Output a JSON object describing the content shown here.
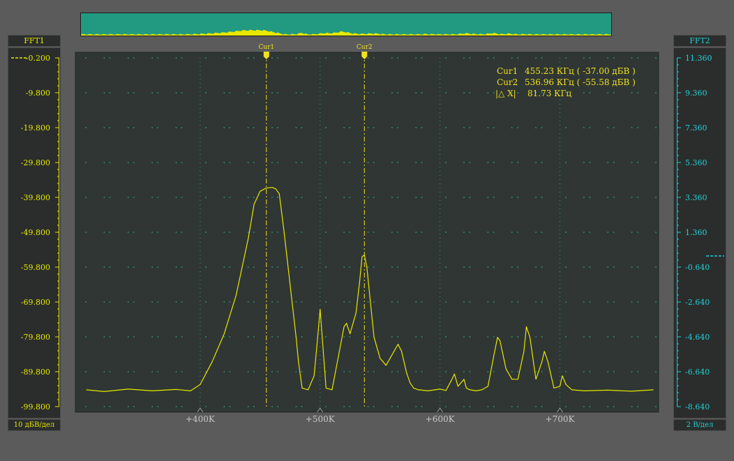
{
  "left_panel": {
    "title": "FFT1",
    "footer": "10 дБВ/дел",
    "color": "#e8e800"
  },
  "right_panel": {
    "title": "FFT2",
    "footer": "2 В/дел",
    "color": "#22d0d6"
  },
  "cursors": [
    {
      "label": "Cur1",
      "x": 455.23
    },
    {
      "label": "Cur2",
      "x": 536.96
    }
  ],
  "readout": {
    "cur1": {
      "name": "Cur1",
      "value": "455.23 КГц ( -37.00 дБВ )"
    },
    "cur2": {
      "name": "Cur2",
      "value": "536.96 КГц ( -55.58 дБВ )"
    },
    "delta": {
      "name": "|△ X|",
      "value": "81.73 КГц"
    }
  },
  "chart_data": {
    "type": "line",
    "title": "",
    "xlabel": "",
    "ylabel": "",
    "xlim": [
      300,
      780
    ],
    "ylim": [
      -99.8,
      -0.2
    ],
    "y2lim": [
      -8.64,
      11.36
    ],
    "grid": true,
    "x_ticks": [
      400,
      500,
      600,
      700
    ],
    "x_tick_labels": [
      "+400K",
      "+500K",
      "+600K",
      "+700K"
    ],
    "y_ticks_left": [
      "-0.200",
      "-9.800",
      "-19.800",
      "-29.800",
      "-39.800",
      "-49.800",
      "-59.800",
      "-69.800",
      "-79.800",
      "-89.800",
      "-99.800"
    ],
    "y_ticks_right": [
      "11.360",
      "9.360",
      "7.360",
      "5.360",
      "3.360",
      "1.360",
      "-0.640",
      "-2.640",
      "-4.640",
      "-6.640",
      "-8.640"
    ],
    "y2_level": 0.0,
    "series": [
      {
        "color": "#e8e800",
        "x": [
          305,
          320,
          340,
          360,
          380,
          392,
          400,
          410,
          420,
          430,
          440,
          445,
          450,
          455,
          460,
          463,
          466,
          470,
          475,
          480,
          482,
          485,
          490,
          495,
          498,
          500,
          502,
          505,
          510,
          515,
          520,
          522,
          525,
          530,
          533,
          535,
          537,
          539,
          542,
          545,
          550,
          555,
          560,
          565,
          568,
          572,
          575,
          578,
          582,
          590,
          600,
          605,
          610,
          612,
          615,
          620,
          622,
          625,
          630,
          635,
          640,
          645,
          648,
          650,
          655,
          660,
          665,
          670,
          672,
          675,
          680,
          685,
          687,
          690,
          695,
          700,
          702,
          705,
          710,
          720,
          740,
          760,
          778
        ],
        "y": [
          -95,
          -95.5,
          -94.8,
          -95.3,
          -94.9,
          -95.3,
          -93.5,
          -87,
          -79,
          -68,
          -52,
          -42,
          -38.3,
          -37.4,
          -37.2,
          -37.6,
          -39,
          -50,
          -65,
          -80,
          -87,
          -94.5,
          -95,
          -91,
          -80,
          -72,
          -81,
          -94.5,
          -95,
          -86,
          -77,
          -76,
          -79,
          -73,
          -64,
          -57,
          -56.5,
          -60,
          -70,
          -80,
          -86,
          -88,
          -85,
          -82,
          -84,
          -90,
          -93,
          -94.5,
          -95,
          -95.3,
          -94.8,
          -95.2,
          -92,
          -90.5,
          -94,
          -92,
          -94.5,
          -95,
          -95.3,
          -95,
          -94,
          -85,
          -80,
          -81,
          -89,
          -92,
          -92,
          -84,
          -77,
          -80,
          -92,
          -87,
          -84,
          -87,
          -94.5,
          -94,
          -91,
          -93.5,
          -95,
          -95.3,
          -95.1,
          -95.4,
          -95
        ]
      }
    ]
  }
}
